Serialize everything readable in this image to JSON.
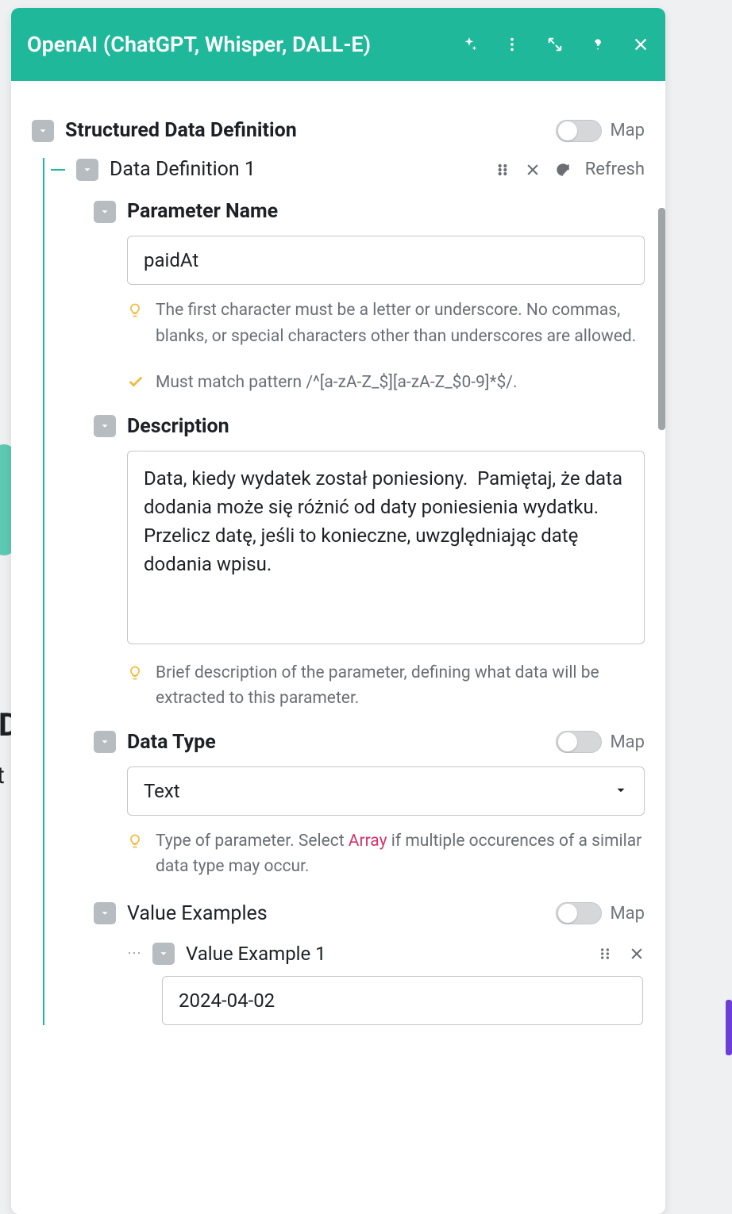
{
  "header": {
    "title": "OpenAI (ChatGPT, Whisper, DALL-E)"
  },
  "top": {
    "title": "Structured Data Definition",
    "map_label": "Map"
  },
  "def": {
    "title": "Data Definition 1",
    "refresh_label": "Refresh"
  },
  "param_name": {
    "label": "Parameter Name",
    "value": "paidAt",
    "hint1": "The first character must be a letter or underscore. No commas, blanks, or special characters other than underscores are allowed.",
    "hint2": "Must match pattern /^[a-zA-Z_$][a-zA-Z_$0-9]*$/."
  },
  "description": {
    "label": "Description",
    "value": "Data, kiedy wydatek został poniesiony.  Pamiętaj, że data dodania może się różnić od daty poniesienia wydatku. Przelicz datę, jeśli to konieczne, uwzględniając datę dodania wpisu.",
    "hint": "Brief description of the parameter, defining what data will be extracted to this parameter."
  },
  "data_type": {
    "label": "Data Type",
    "map_label": "Map",
    "value": "Text",
    "hint_prefix": "Type of parameter. Select ",
    "hint_code": "Array",
    "hint_suffix": " if multiple occurences of a similar data type may occur."
  },
  "value_examples": {
    "label": "Value Examples",
    "map_label": "Map",
    "item_label": "Value Example 1",
    "item_value": "2024-04-02"
  }
}
